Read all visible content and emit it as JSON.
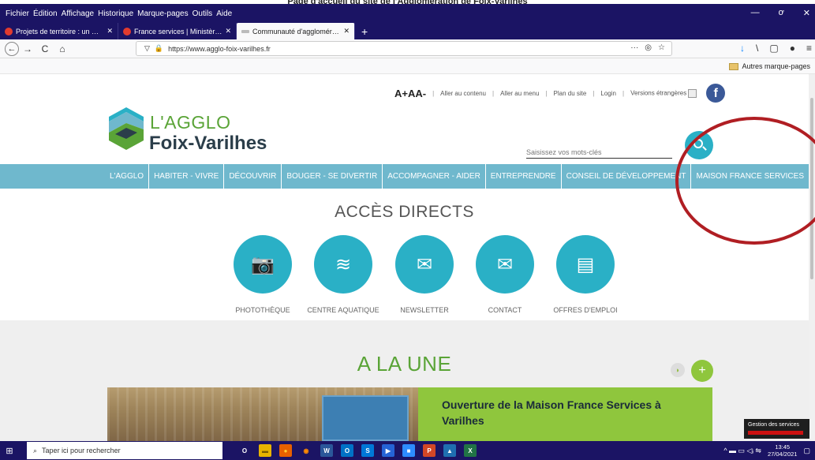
{
  "title_text": "Page d'accueil du site de l'Agglomération de Foix-Varilhes",
  "menu_bar": [
    "Fichier",
    "Édition",
    "Affichage",
    "Historique",
    "Marque-pages",
    "Outils",
    "Aide"
  ],
  "window_controls": [
    "—",
    "ơ",
    "✕"
  ],
  "tabs": [
    {
      "label": "Projets de territoire : un mode",
      "close": "✕"
    },
    {
      "label": "France services | Ministère de l",
      "close": "✕"
    },
    {
      "label": "Communauté d'agglomération",
      "close": "✕"
    }
  ],
  "new_tab": "+",
  "nav": {
    "back": "←",
    "forward": "→",
    "reload": "C",
    "home": "⌂",
    "url": "https://www.agglo-foix-varilhes.fr",
    "more": "···",
    "shield": "◎",
    "star": "☆"
  },
  "toolbar_right": [
    "↓",
    "\\",
    "▢",
    "●",
    "≡"
  ],
  "bookmarks": {
    "other": "Autres marque-pages"
  },
  "accessibility": {
    "font_size_label": "A+AA-",
    "links": [
      "Aller au contenu",
      "Aller au menu",
      "Plan du site",
      "Login",
      "Versions étrangères"
    ],
    "separator": "|",
    "facebook": "f"
  },
  "logo": {
    "line1": "L'AGGLO",
    "line2": "Foix-Varilhes"
  },
  "search": {
    "placeholder": "Saisissez vos mots-clés"
  },
  "main_nav": [
    "L'AGGLO",
    "HABITER - VIVRE",
    "DÉCOUVRIR",
    "BOUGER - SE DIVERTIR",
    "ACCOMPAGNER - AIDER",
    "ENTREPRENDRE",
    "CONSEIL DE DÉVELOPPEMENT",
    "MAISON FRANCE SERVICES"
  ],
  "direct_access": {
    "title": "ACCÈS DIRECTS",
    "items": [
      {
        "label": "PHOTOTHÈQUE",
        "icon": "📷"
      },
      {
        "label": "CENTRE AQUATIQUE",
        "icon": "≋"
      },
      {
        "label": "NEWSLETTER",
        "icon": "✉"
      },
      {
        "label": "CONTACT",
        "icon": "✉"
      },
      {
        "label": "OFFRES D'EMPLOI",
        "icon": "▤"
      }
    ]
  },
  "une": {
    "title": "A LA UNE",
    "rss": "◗",
    "plus": "+",
    "news_title": "Ouverture de la Maison France Services à Varilhes"
  },
  "tooltip": {
    "text": "Gestion des services"
  },
  "taskbar": {
    "start": "⊞",
    "search_placeholder": "Taper ici pour rechercher",
    "search_icon": "⌕",
    "apps": [
      {
        "glyph": "O",
        "color": "#1b1464",
        "fg": "#fff"
      },
      {
        "glyph": "▬",
        "color": "#e8b400",
        "fg": "#7a5b00"
      },
      {
        "glyph": "●",
        "color": "#e66000",
        "fg": "#ffcc33"
      },
      {
        "glyph": "◉",
        "color": "#1b1464",
        "fg": "#ff8a00"
      },
      {
        "glyph": "W",
        "color": "#2b579a",
        "fg": "#fff"
      },
      {
        "glyph": "O",
        "color": "#0072c6",
        "fg": "#fff"
      },
      {
        "glyph": "S",
        "color": "#0078d7",
        "fg": "#fff"
      },
      {
        "glyph": "▶",
        "color": "#2563d6",
        "fg": "#fff"
      },
      {
        "glyph": "■",
        "color": "#2d8cff",
        "fg": "#fff"
      },
      {
        "glyph": "P",
        "color": "#d24726",
        "fg": "#fff"
      },
      {
        "glyph": "▲",
        "color": "#1f6fb0",
        "fg": "#fff"
      },
      {
        "glyph": "X",
        "color": "#217346",
        "fg": "#fff"
      }
    ],
    "tray": "^ ▬ ▭ ◁ᵢ ⇋",
    "time": "13:45",
    "date": "27/04/2021",
    "notif": "▢"
  },
  "colors": {
    "teal": "#2ab0c6",
    "nav_blue": "#6fb8cd",
    "green": "#5aa437",
    "lime": "#8fc63d",
    "browser_dark": "#1b1464",
    "annotation_red": "#b01e23"
  }
}
